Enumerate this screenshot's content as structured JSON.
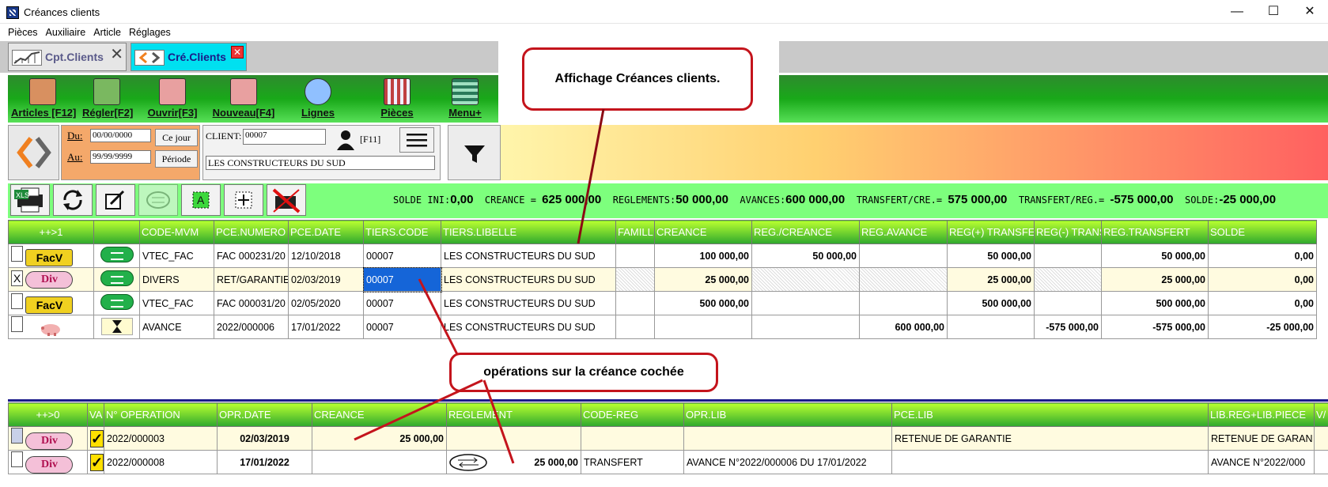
{
  "window": {
    "title": "Créances clients",
    "controls": [
      "—",
      "☐",
      "✕"
    ]
  },
  "menu": [
    "Pièces",
    "Auxiliaire",
    "Article",
    "Réglages"
  ],
  "tabs": [
    {
      "label": "Cpt.Clients"
    },
    {
      "label": "Cré.Clients"
    }
  ],
  "toolbar": [
    {
      "label": "Articles [F12]",
      "icon": "articles-icon"
    },
    {
      "label": "Régler[F2]",
      "icon": "money-icon"
    },
    {
      "label": "Ouvrir[F3]",
      "icon": "open-icon"
    },
    {
      "label": "Nouveau[F4]",
      "icon": "new-icon"
    },
    {
      "label": "Lignes",
      "icon": "magnifier-icon"
    },
    {
      "label": "Pièces",
      "icon": "pieces-icon"
    },
    {
      "label": "Menu+",
      "icon": "menu-icon"
    }
  ],
  "callouts": {
    "top": "Affichage Créances clients.",
    "middle": "opérations sur la créance cochée"
  },
  "filters": {
    "du_label": "Du:",
    "du_value": "00/00/0000",
    "ce_jour": "Ce jour",
    "au_label": "Au:",
    "au_value": "99/99/9999",
    "periode": "Période",
    "client_label": "CLIENT:",
    "client_code": "00007",
    "f11": "[F11]",
    "client_name": "LES CONSTRUCTEURS DU SUD"
  },
  "solde": {
    "ini_label": "SOLDE INI:",
    "ini": "0,00",
    "creance_label": "CREANCE =",
    "creance": "625 000,00",
    "reglements_label": "REGLEMENTS:",
    "reglements": "50 000,00",
    "avances_label": "AVANCES:",
    "avances": "600 000,00",
    "tcre_label": "TRANSFERT/CRE.=",
    "tcre": "575 000,00",
    "treg_label": "TRANSFERT/REG.=",
    "treg": "-575 000,00",
    "solde_label": "SOLDE:",
    "solde": "-25 000,00"
  },
  "grid1": {
    "headers": [
      "++>1",
      "",
      "CODE-MVM",
      "PCE.NUMERO",
      "PCE.DATE",
      "TIERS.CODE",
      "TIERS.LIBELLE",
      "FAMILL",
      "CREANCE",
      "REG./CREANCE",
      "REG.AVANCE",
      "REG(+) TRANSFE",
      "REG(-) TRANS",
      "REG.TRANSFERT",
      "SOLDE"
    ],
    "rows": [
      {
        "check": "",
        "badge": "FacV",
        "code": "VTEC_FAC",
        "numero": "FAC 000231/20",
        "date": "12/10/2018",
        "tiers": "00007",
        "libelle": "LES CONSTRUCTEURS DU SUD",
        "famille": "",
        "creance": "100 000,00",
        "regcre": "50 000,00",
        "regav": "",
        "regplus": "50 000,00",
        "regmoins": "",
        "regtr": "50 000,00",
        "solde": "0,00"
      },
      {
        "check": "X",
        "badge": "Div",
        "code": "DIVERS",
        "numero": "RET/GARANTIE",
        "date": "02/03/2019",
        "tiers": "00007",
        "libelle": "LES CONSTRUCTEURS DU SUD",
        "famille": "",
        "creance": "25 000,00",
        "regcre": "",
        "regav": "",
        "regplus": "25 000,00",
        "regmoins": "",
        "regtr": "25 000,00",
        "solde": "0,00"
      },
      {
        "check": "",
        "badge": "FacV",
        "code": "VTEC_FAC",
        "numero": "FAC 000031/20",
        "date": "02/05/2020",
        "tiers": "00007",
        "libelle": "LES CONSTRUCTEURS DU SUD",
        "famille": "",
        "creance": "500 000,00",
        "regcre": "",
        "regav": "",
        "regplus": "500 000,00",
        "regmoins": "",
        "regtr": "500 000,00",
        "solde": "0,00"
      },
      {
        "check": "",
        "badge": "",
        "code": "AVANCE",
        "numero": "2022/000006",
        "date": "17/01/2022",
        "tiers": "00007",
        "libelle": "LES CONSTRUCTEURS DU SUD",
        "famille": "",
        "creance": "",
        "regcre": "",
        "regav": "600 000,00",
        "regplus": "",
        "regmoins": "-575 000,00",
        "regtr": "-575 000,00",
        "solde": "-25 000,00"
      }
    ]
  },
  "grid2": {
    "headers": [
      "++>0",
      "VA",
      "N° OPERATION",
      "OPR.DATE",
      "CREANCE",
      "REGLEMENT",
      "CODE-REG",
      "OPR.LIB",
      "PCE.LIB",
      "LIB.REG+LIB.PIECE",
      "V/"
    ],
    "rows": [
      {
        "badge": "Div",
        "va": "✓",
        "num": "2022/000003",
        "date": "02/03/2019",
        "creance": "25 000,00",
        "reglement": "",
        "codereg": "",
        "oprlib": "",
        "pcelib": "RETENUE DE GARANTIE",
        "lib": "RETENUE DE GARAN"
      },
      {
        "badge": "Div",
        "va": "✓",
        "num": "2022/000008",
        "date": "17/01/2022",
        "creance": "",
        "reglement": "25 000,00",
        "codereg": "TRANSFERT",
        "oprlib": "AVANCE N°2022/000006 DU 17/01/2022",
        "pcelib": "",
        "lib": "AVANCE N°2022/000"
      }
    ]
  }
}
